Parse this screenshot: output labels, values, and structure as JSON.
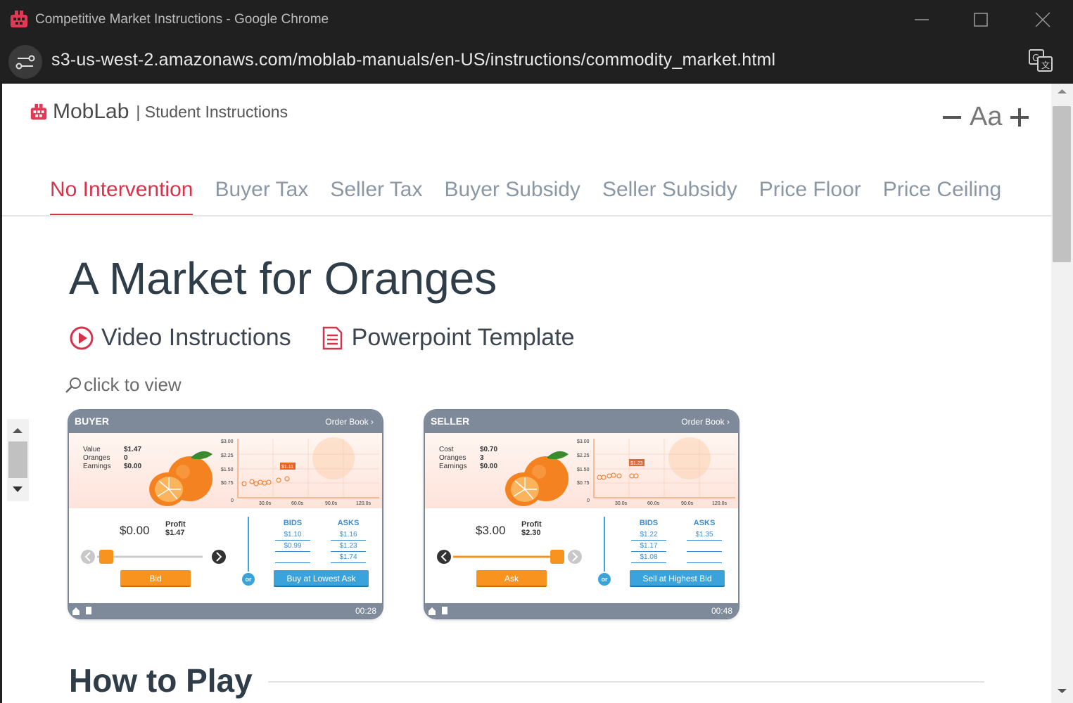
{
  "window": {
    "title": "Competitive Market Instructions - Google Chrome",
    "url": "s3-us-west-2.amazonaws.com/moblab-manuals/en-US/instructions/commodity_market.html"
  },
  "brand": {
    "name": "MobLab",
    "subtitle": "| Student Instructions",
    "accent": "#d6334b"
  },
  "font_control": {
    "label": "Aa"
  },
  "tabs": [
    {
      "label": "No Intervention",
      "active": true
    },
    {
      "label": "Buyer Tax"
    },
    {
      "label": "Seller Tax"
    },
    {
      "label": "Buyer Subsidy"
    },
    {
      "label": "Seller Subsidy"
    },
    {
      "label": "Price Floor"
    },
    {
      "label": "Price Ceiling"
    }
  ],
  "main": {
    "title": "A Market for Oranges",
    "video_link": "Video Instructions",
    "ppt_link": "Powerpoint Template",
    "zoom_hint": "click to view",
    "how_to_play": "How to Play"
  },
  "buyer": {
    "role": "BUYER",
    "order_book": "Order Book ›",
    "stats": [
      {
        "k": "Value",
        "v": "$1.47"
      },
      {
        "k": "Oranges",
        "v": "0"
      },
      {
        "k": "Earnings",
        "v": "$0.00"
      }
    ],
    "price": "$0.00",
    "profit_label": "Profit",
    "profit_value": "$1.47",
    "action": "Bid",
    "alt_action": "Buy at Lowest Ask",
    "or": "or",
    "bids_label": "BIDS",
    "asks_label": "ASKS",
    "bids": [
      "$1.10",
      "$0.99",
      ""
    ],
    "asks": [
      "$1.16",
      "$1.23",
      "$1.74"
    ],
    "timer": "00:28",
    "chart_tag": "$1.11",
    "y_ticks": [
      "$3.00",
      "$2.25",
      "$1.50",
      "$0.75",
      "0"
    ],
    "x_ticks": [
      "30.0s",
      "60.0s",
      "90.0s",
      "120.0s"
    ]
  },
  "seller": {
    "role": "SELLER",
    "order_book": "Order Book ›",
    "stats": [
      {
        "k": "Cost",
        "v": "$0.70"
      },
      {
        "k": "Oranges",
        "v": "3"
      },
      {
        "k": "Earnings",
        "v": "$0.00"
      }
    ],
    "price": "$3.00",
    "profit_label": "Profit",
    "profit_value": "$2.30",
    "action": "Ask",
    "alt_action": "Sell at Highest Bid",
    "or": "or",
    "bids_label": "BIDS",
    "asks_label": "ASKS",
    "bids": [
      "$1.22",
      "$1.17",
      "$1.08"
    ],
    "asks": [
      "$1.35",
      "",
      ""
    ],
    "timer": "00:48",
    "chart_tag": "$1.23",
    "y_ticks": [
      "$3.00",
      "$2.25",
      "$1.50",
      "$0.75",
      "0"
    ],
    "x_ticks": [
      "30.0s",
      "60.0s",
      "90.0s",
      "120.0s"
    ]
  }
}
